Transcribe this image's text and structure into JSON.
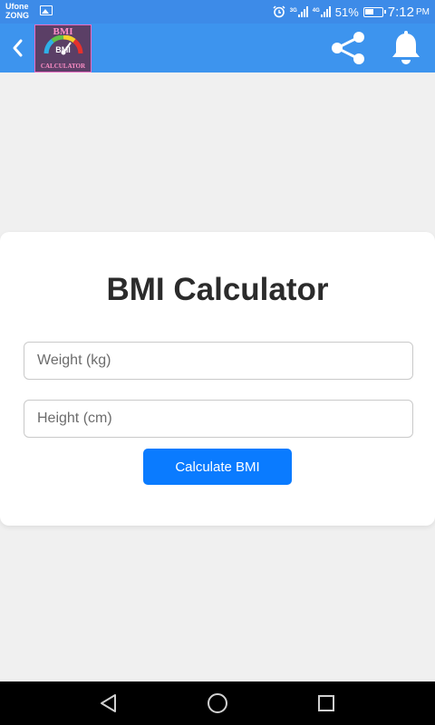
{
  "status_bar": {
    "carrier_line1": "Ufone",
    "carrier_line2": "ZONG",
    "net1": "3G",
    "net2": "4G",
    "battery": "51%",
    "time": "7:12",
    "ampm": "PM"
  },
  "app_bar": {
    "logo_top": "BMI",
    "logo_mid": "BMI",
    "logo_bottom": "CALCULATOR",
    "icons": [
      "back-icon",
      "share-icon",
      "bell-icon"
    ]
  },
  "card": {
    "title": "BMI Calculator",
    "weight": {
      "placeholder": "Weight (kg)",
      "value": ""
    },
    "height": {
      "placeholder": "Height (cm)",
      "value": ""
    },
    "button_label": "Calculate BMI"
  },
  "nav_bar": {
    "icons": [
      "back-triangle-icon",
      "home-circle-icon",
      "recents-square-icon"
    ]
  },
  "colors": {
    "status_bar": "#3d8be8",
    "app_bar": "#3d94ee",
    "button": "#0a7bff",
    "background": "#f0f0f0"
  }
}
